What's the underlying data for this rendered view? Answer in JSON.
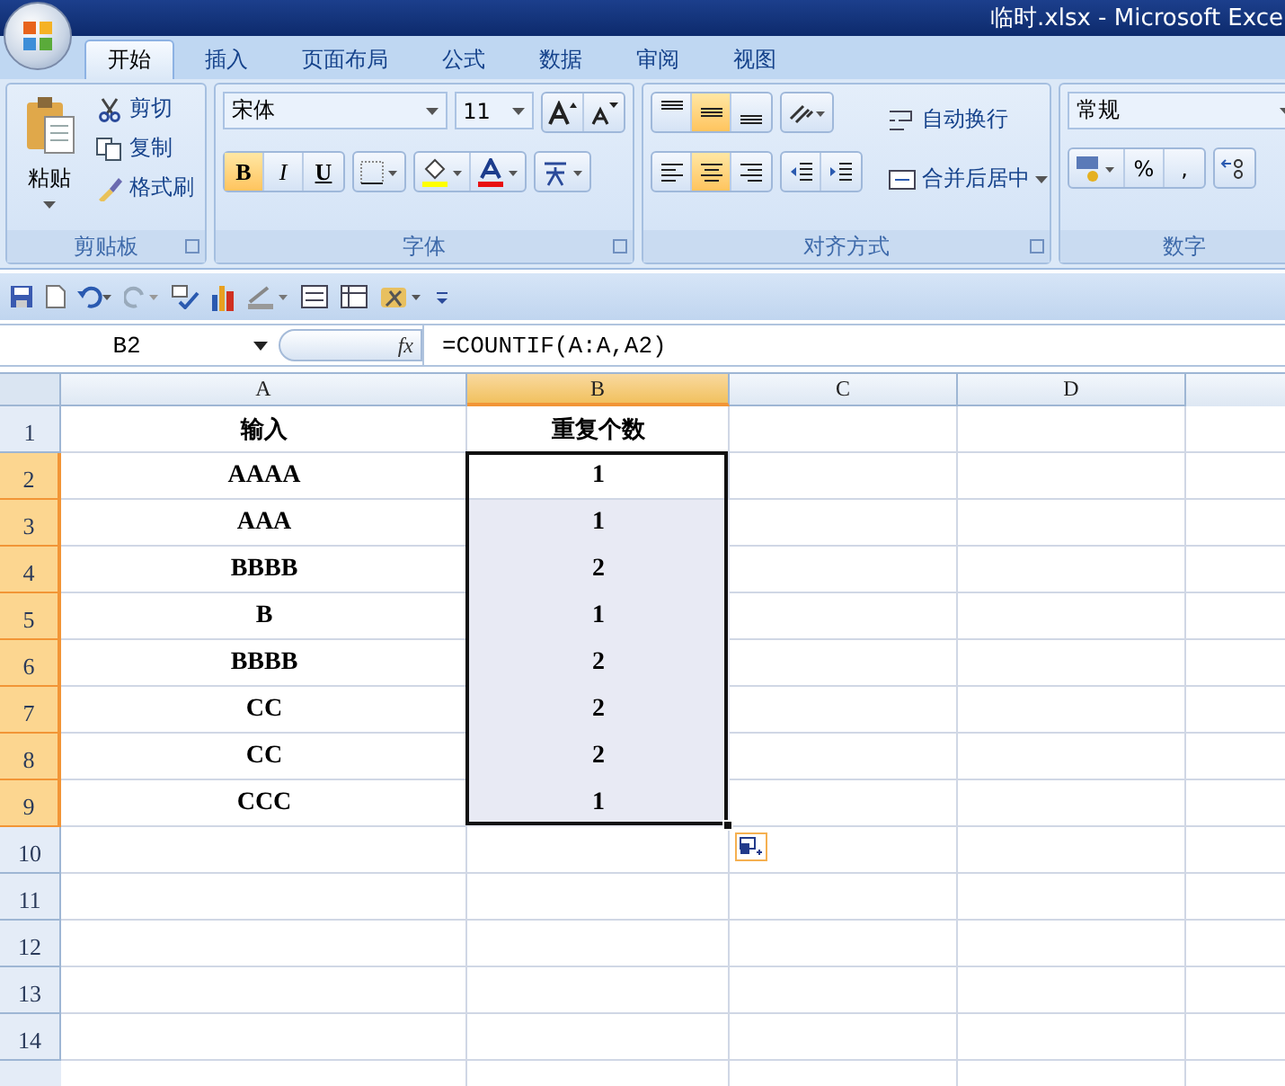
{
  "window": {
    "title": "临时.xlsx - Microsoft Exce"
  },
  "ribbon_tabs": [
    {
      "label": "开始",
      "selected": true
    },
    {
      "label": "插入",
      "selected": false
    },
    {
      "label": "页面布局",
      "selected": false
    },
    {
      "label": "公式",
      "selected": false
    },
    {
      "label": "数据",
      "selected": false
    },
    {
      "label": "审阅",
      "selected": false
    },
    {
      "label": "视图",
      "selected": false
    }
  ],
  "clipboard": {
    "label": "剪贴板",
    "paste": "粘贴",
    "cut": "剪切",
    "copy": "复制",
    "format_painter": "格式刷"
  },
  "font": {
    "label": "字体",
    "font_name": "宋体",
    "font_size": "11",
    "bold": {
      "label": "B",
      "on": true
    },
    "italic": {
      "label": "I",
      "on": false
    },
    "underline": {
      "label": "U",
      "on": false
    }
  },
  "alignment": {
    "label": "对齐方式",
    "vertical": [
      {
        "selected": false
      },
      {
        "selected": true
      },
      {
        "selected": false
      }
    ],
    "horizontal": [
      {
        "selected": false
      },
      {
        "selected": true
      },
      {
        "selected": false
      }
    ],
    "wrap_text": "自动换行",
    "merge_center": "合并后居中"
  },
  "number": {
    "label": "数字",
    "format": "常规",
    "percent": "%",
    "comma": ","
  },
  "formula_bar": {
    "name_box": "B2",
    "fx": "fx",
    "formula": "=COUNTIF(A:A,A2)"
  },
  "sheet": {
    "columns": [
      {
        "label": "A",
        "selected": false
      },
      {
        "label": "B",
        "selected": true
      },
      {
        "label": "C",
        "selected": false
      },
      {
        "label": "D",
        "selected": false
      }
    ],
    "rows": [
      {
        "number": "1",
        "selected": false,
        "cells": [
          "输入",
          "重复个数"
        ]
      },
      {
        "number": "2",
        "selected": true,
        "cells": [
          "AAAA",
          "1"
        ]
      },
      {
        "number": "3",
        "selected": true,
        "cells": [
          "AAA",
          "1"
        ]
      },
      {
        "number": "4",
        "selected": true,
        "cells": [
          "BBBB",
          "2"
        ]
      },
      {
        "number": "5",
        "selected": true,
        "cells": [
          "B",
          "1"
        ]
      },
      {
        "number": "6",
        "selected": true,
        "cells": [
          "BBBB",
          "2"
        ]
      },
      {
        "number": "7",
        "selected": true,
        "cells": [
          "CC",
          "2"
        ]
      },
      {
        "number": "8",
        "selected": true,
        "cells": [
          "CC",
          "2"
        ]
      },
      {
        "number": "9",
        "selected": true,
        "cells": [
          "CCC",
          "1"
        ]
      },
      {
        "number": "10",
        "selected": false,
        "cells": []
      },
      {
        "number": "11",
        "selected": false,
        "cells": []
      },
      {
        "number": "12",
        "selected": false,
        "cells": []
      },
      {
        "number": "13",
        "selected": false,
        "cells": []
      },
      {
        "number": "14",
        "selected": false,
        "cells": []
      }
    ]
  }
}
